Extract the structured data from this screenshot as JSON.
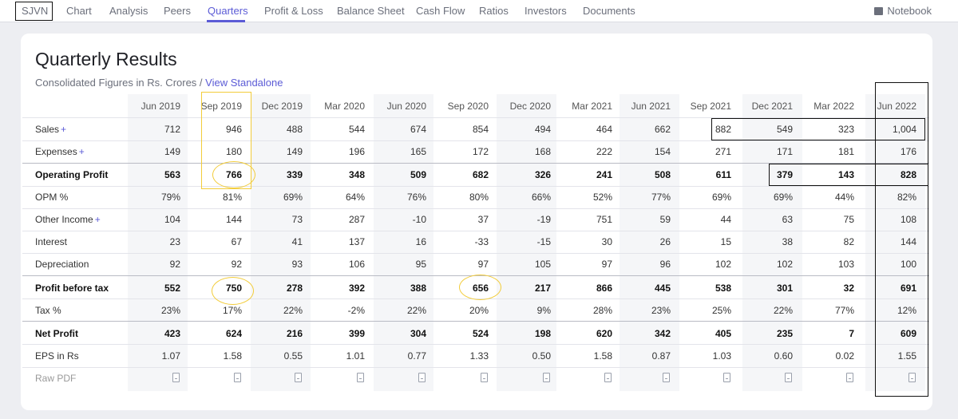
{
  "nav": {
    "company": "SJVN",
    "items": [
      "Chart",
      "Analysis",
      "Peers",
      "Quarters",
      "Profit & Loss",
      "Balance Sheet",
      "Cash Flow",
      "Ratios",
      "Investors",
      "Documents"
    ],
    "active": "Quarters",
    "notebook": "Notebook"
  },
  "section": {
    "title": "Quarterly Results",
    "subtitle": "Consolidated Figures in Rs. Crores /",
    "link": "View Standalone"
  },
  "table": {
    "columns": [
      "Jun 2019",
      "Sep 2019",
      "Dec 2019",
      "Mar 2020",
      "Jun 2020",
      "Sep 2020",
      "Dec 2020",
      "Mar 2021",
      "Jun 2021",
      "Sep 2021",
      "Dec 2021",
      "Mar 2022",
      "Jun 2022"
    ],
    "rows": [
      {
        "label": "Sales",
        "plus": "+",
        "bold": false,
        "values": [
          "712",
          "946",
          "488",
          "544",
          "674",
          "854",
          "494",
          "464",
          "662",
          "882",
          "549",
          "323",
          "1,004"
        ]
      },
      {
        "label": "Expenses",
        "plus": "+",
        "bold": false,
        "values": [
          "149",
          "180",
          "149",
          "196",
          "165",
          "172",
          "168",
          "222",
          "154",
          "271",
          "171",
          "181",
          "176"
        ]
      },
      {
        "label": "Operating Profit",
        "plus": "",
        "bold": true,
        "values": [
          "563",
          "766",
          "339",
          "348",
          "509",
          "682",
          "326",
          "241",
          "508",
          "611",
          "379",
          "143",
          "828"
        ]
      },
      {
        "label": "OPM %",
        "plus": "",
        "bold": false,
        "values": [
          "79%",
          "81%",
          "69%",
          "64%",
          "76%",
          "80%",
          "66%",
          "52%",
          "77%",
          "69%",
          "69%",
          "44%",
          "82%"
        ]
      },
      {
        "label": "Other Income",
        "plus": "+",
        "bold": false,
        "values": [
          "104",
          "144",
          "73",
          "287",
          "-10",
          "37",
          "-19",
          "751",
          "59",
          "44",
          "63",
          "75",
          "108"
        ]
      },
      {
        "label": "Interest",
        "plus": "",
        "bold": false,
        "values": [
          "23",
          "67",
          "41",
          "137",
          "16",
          "-33",
          "-15",
          "30",
          "26",
          "15",
          "38",
          "82",
          "144"
        ]
      },
      {
        "label": "Depreciation",
        "plus": "",
        "bold": false,
        "values": [
          "92",
          "92",
          "93",
          "106",
          "95",
          "97",
          "105",
          "97",
          "96",
          "102",
          "102",
          "103",
          "100"
        ]
      },
      {
        "label": "Profit before tax",
        "plus": "",
        "bold": true,
        "values": [
          "552",
          "750",
          "278",
          "392",
          "388",
          "656",
          "217",
          "866",
          "445",
          "538",
          "301",
          "32",
          "691"
        ]
      },
      {
        "label": "Tax %",
        "plus": "",
        "bold": false,
        "values": [
          "23%",
          "17%",
          "22%",
          "-2%",
          "22%",
          "20%",
          "9%",
          "28%",
          "23%",
          "25%",
          "22%",
          "77%",
          "12%"
        ]
      },
      {
        "label": "Net Profit",
        "plus": "",
        "bold": true,
        "values": [
          "423",
          "624",
          "216",
          "399",
          "304",
          "524",
          "198",
          "620",
          "342",
          "405",
          "235",
          "7",
          "609"
        ]
      },
      {
        "label": "EPS in Rs",
        "plus": "",
        "bold": false,
        "values": [
          "1.07",
          "1.58",
          "0.55",
          "1.01",
          "0.77",
          "1.33",
          "0.50",
          "1.58",
          "0.87",
          "1.03",
          "0.60",
          "0.02",
          "1.55"
        ]
      }
    ],
    "raw_pdf_label": "Raw PDF"
  },
  "colors": {
    "accent": "#5b5bd6",
    "annotation_yellow": "#f2cc3a",
    "annotation_black": "#111111"
  }
}
